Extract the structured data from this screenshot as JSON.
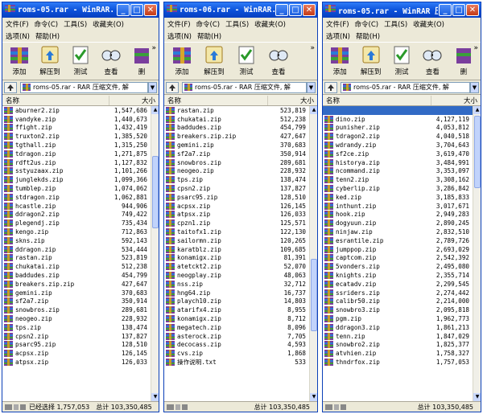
{
  "windows": [
    {
      "title": "roms-05.rar - WinRAR...",
      "menu": [
        "文件(F)",
        "命令(C)",
        "工具(S)",
        "收藏夹(O)"
      ],
      "menu2": [
        "选项(N)",
        "帮助(H)"
      ],
      "tools": [
        "添加",
        "解压到",
        "测试",
        "查看",
        "删"
      ],
      "address": "roms-05.rar - RAR 压缩文件, 解",
      "header": {
        "name": "名称",
        "size": "大小"
      },
      "status_left": "已经选择 1,757,053",
      "status_right": "总计 103,350,485",
      "files": [
        {
          "name": "aburner2.zip",
          "size": "1,547,686"
        },
        {
          "name": "vandyke.zip",
          "size": "1,440,673"
        },
        {
          "name": "ffight.zip",
          "size": "1,432,419"
        },
        {
          "name": "truxton2.zip",
          "size": "1,385,520"
        },
        {
          "name": "tgthall.zip",
          "size": "1,315,250"
        },
        {
          "name": "tdragon.zip",
          "size": "1,271,875"
        },
        {
          "name": "rdft2us.zip",
          "size": "1,127,832"
        },
        {
          "name": "sstyuzaax.zip",
          "size": "1,101,266"
        },
        {
          "name": "junglekds.zip",
          "size": "1,099,366"
        },
        {
          "name": "tumblep.zip",
          "size": "1,074,062"
        },
        {
          "name": "stdragon.zip",
          "size": "1,062,881"
        },
        {
          "name": "hcastle.zip",
          "size": "944,906"
        },
        {
          "name": "ddragon2.zip",
          "size": "749,422"
        },
        {
          "name": "plegendj.zip",
          "size": "735,434"
        },
        {
          "name": "kengo.zip",
          "size": "712,863"
        },
        {
          "name": "skns.zip",
          "size": "592,143"
        },
        {
          "name": "ddragon.zip",
          "size": "534,444"
        },
        {
          "name": "rastan.zip",
          "size": "523,819"
        },
        {
          "name": "chukatai.zip",
          "size": "512,238"
        },
        {
          "name": "baddudes.zip",
          "size": "454,799"
        },
        {
          "name": "breakers.zip.zip",
          "size": "427,647"
        },
        {
          "name": "gemini.zip",
          "size": "370,683"
        },
        {
          "name": "sf2a7.zip",
          "size": "350,914"
        },
        {
          "name": "snowbros.zip",
          "size": "289,681"
        },
        {
          "name": "neogeo.zip",
          "size": "228,932"
        },
        {
          "name": "tps.zip",
          "size": "138,474"
        },
        {
          "name": "cpsn2.zip",
          "size": "137,827"
        },
        {
          "name": "psarc95.zip",
          "size": "128,510"
        },
        {
          "name": "acpsx.zip",
          "size": "126,145"
        },
        {
          "name": "atpsx.zip",
          "size": "126,033"
        }
      ]
    },
    {
      "title": "roms-06.rar - WinRAR...",
      "menu": [
        "文件(F)",
        "命令(C)",
        "工具(S)",
        "收藏夹(O)"
      ],
      "menu2": [
        "选项(N)",
        "帮助(H)"
      ],
      "tools": [
        "添加",
        "解压到",
        "测试",
        "查看"
      ],
      "address": "roms-05.rar - RAR 压缩文件, 解",
      "header": {
        "name": "名称",
        "size": "大小"
      },
      "status_left": "",
      "status_right": "总计 103,350,485",
      "files": [
        {
          "name": "rastan.zip",
          "size": "523,819"
        },
        {
          "name": "chukatai.zip",
          "size": "512,238"
        },
        {
          "name": "baddudes.zip",
          "size": "454,799"
        },
        {
          "name": "breakers.zip.zip",
          "size": "427,647"
        },
        {
          "name": "gemini.zip",
          "size": "370,683"
        },
        {
          "name": "sf2a7.zip",
          "size": "350,914"
        },
        {
          "name": "snowbros.zip",
          "size": "289,681"
        },
        {
          "name": "neogeo.zip",
          "size": "228,932"
        },
        {
          "name": "tps.zip",
          "size": "138,474"
        },
        {
          "name": "cpsn2.zip",
          "size": "137,827"
        },
        {
          "name": "psarc95.zip",
          "size": "128,510"
        },
        {
          "name": "acpsx.zip",
          "size": "126,145"
        },
        {
          "name": "atpsx.zip",
          "size": "126,033"
        },
        {
          "name": "cpzn1.zip",
          "size": "125,571"
        },
        {
          "name": "taitofx1.zip",
          "size": "122,130"
        },
        {
          "name": "sailormn.zip",
          "size": "120,265"
        },
        {
          "name": "karatblz.zip",
          "size": "109,685"
        },
        {
          "name": "konamigx.zip",
          "size": "81,391"
        },
        {
          "name": "atetckt2.zip",
          "size": "52,070"
        },
        {
          "name": "neogplay.zip",
          "size": "48,063"
        },
        {
          "name": "nss.zip",
          "size": "32,712"
        },
        {
          "name": "hng64.zip",
          "size": "16,737"
        },
        {
          "name": "playch10.zip",
          "size": "14,803"
        },
        {
          "name": "atarifx4.zip",
          "size": "8,955"
        },
        {
          "name": "konamigx.zip",
          "size": "8,712"
        },
        {
          "name": "megatech.zip",
          "size": "8,096"
        },
        {
          "name": "asterock.zip",
          "size": "7,705"
        },
        {
          "name": "decocass.zip",
          "size": "4,593"
        },
        {
          "name": "cvs.zip",
          "size": "1,868"
        },
        {
          "name": "操作说明.txt",
          "size": "533"
        }
      ]
    },
    {
      "title": "roms-05.rar - WinRAR 压缩文件",
      "menu": [
        "文件(F)",
        "命令(C)",
        "工具(S)",
        "收藏夹(O)"
      ],
      "menu2": [
        "选项(N)",
        "帮助(H)"
      ],
      "tools": [
        "添加",
        "解压到",
        "测试",
        "查看",
        "删"
      ],
      "address": "roms-05.rar - RAR 压缩文件, 解",
      "header": {
        "name": "名称",
        "size": "大小"
      },
      "status_left": "",
      "status_right": "总计 103,350,485",
      "files": [
        {
          "name": "",
          "size": ""
        },
        {
          "name": "dino.zip",
          "size": "4,127,119"
        },
        {
          "name": "punisher.zip",
          "size": "4,053,812"
        },
        {
          "name": "tdragon2.zip",
          "size": "4,040,518"
        },
        {
          "name": "wdrandy.zip",
          "size": "3,704,643"
        },
        {
          "name": "sf2ce.zip",
          "size": "3,619,470"
        },
        {
          "name": "historya.zip",
          "size": "3,484,991"
        },
        {
          "name": "ncommand.zip",
          "size": "3,353,097"
        },
        {
          "name": "tenn2.zip",
          "size": "3,308,162"
        },
        {
          "name": "cyberlip.zip",
          "size": "3,286,842"
        },
        {
          "name": "ked.zip",
          "size": "3,185,833"
        },
        {
          "name": "inthunt.zip",
          "size": "3,017,671"
        },
        {
          "name": "hook.zip",
          "size": "2,949,283"
        },
        {
          "name": "dogyuun.zip",
          "size": "2,890,245"
        },
        {
          "name": "ninjaw.zip",
          "size": "2,832,510"
        },
        {
          "name": "esrantile.zip",
          "size": "2,789,726"
        },
        {
          "name": "jumppop.zip",
          "size": "2,693,029"
        },
        {
          "name": "captcom.zip",
          "size": "2,542,392"
        },
        {
          "name": "5vonders.zip",
          "size": "2,495,080"
        },
        {
          "name": "knights.zip",
          "size": "2,355,714"
        },
        {
          "name": "ecatadv.zip",
          "size": "2,299,545"
        },
        {
          "name": "ssriders.zip",
          "size": "2,274,442"
        },
        {
          "name": "calibr50.zip",
          "size": "2,214,000"
        },
        {
          "name": "snowbro3.zip",
          "size": "2,095,818"
        },
        {
          "name": "pgm.zip",
          "size": "1,962,773"
        },
        {
          "name": "ddragon3.zip",
          "size": "1,861,213"
        },
        {
          "name": "tenn.zip",
          "size": "1,847,029"
        },
        {
          "name": "snowbro2.zip",
          "size": "1,825,377"
        },
        {
          "name": "atvhien.zip",
          "size": "1,758,327"
        },
        {
          "name": "thndrfox.zip",
          "size": "1,757,053"
        }
      ]
    }
  ],
  "colors": {
    "titlebar": "#0a4fd8",
    "selection": "#316ac5",
    "chrome": "#ece9d8"
  },
  "icons": {
    "file": "rar-archive-icon",
    "up": "up-folder-icon"
  }
}
